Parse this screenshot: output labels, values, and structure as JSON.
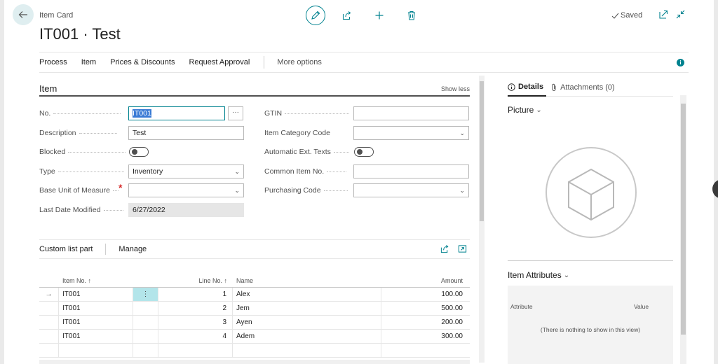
{
  "header": {
    "breadcrumb": "Item Card",
    "title": "IT001 · Test",
    "saved_label": "Saved",
    "icons": [
      "back-arrow-icon",
      "edit-pencil-icon",
      "share-icon",
      "add-plus-icon",
      "delete-trash-icon",
      "open-new-window-icon",
      "collapse-icon"
    ]
  },
  "actions": {
    "items": [
      "Process",
      "Item",
      "Prices & Discounts",
      "Request Approval"
    ],
    "more": "More options",
    "info": "i"
  },
  "section": {
    "title": "Item",
    "show_less": "Show less"
  },
  "fields": {
    "no_label": "No.",
    "no_value": "IT001",
    "no_more": "···",
    "description_label": "Description",
    "description_value": "Test",
    "blocked_label": "Blocked",
    "blocked_value": false,
    "type_label": "Type",
    "type_value": "Inventory",
    "base_uom_label": "Base Unit of Measure",
    "base_uom_value": "",
    "required_mark": "*",
    "last_modified_label": "Last Date Modified",
    "last_modified_value": "6/27/2022",
    "gtin_label": "GTIN",
    "gtin_value": "",
    "category_label": "Item Category Code",
    "category_value": "",
    "auto_ext_label": "Automatic Ext. Texts",
    "auto_ext_value": false,
    "common_item_label": "Common Item No.",
    "common_item_value": "",
    "purchasing_label": "Purchasing Code",
    "purchasing_value": ""
  },
  "list_part": {
    "title": "Custom list part",
    "manage": "Manage",
    "columns": {
      "item_no": "Item No. ↑",
      "line_no": "Line No. ↑",
      "name": "Name",
      "amount": "Amount"
    },
    "rows": [
      {
        "arrow": "→",
        "item_no": "IT001",
        "menu": "⋮",
        "line_no": "1",
        "name": "Alex",
        "amount": "100.00"
      },
      {
        "arrow": "",
        "item_no": "IT001",
        "menu": "",
        "line_no": "2",
        "name": "Jem",
        "amount": "500.00"
      },
      {
        "arrow": "",
        "item_no": "IT001",
        "menu": "",
        "line_no": "3",
        "name": "Ayen",
        "amount": "200.00"
      },
      {
        "arrow": "",
        "item_no": "IT001",
        "menu": "",
        "line_no": "4",
        "name": "Adem",
        "amount": "300.00"
      },
      {
        "arrow": "",
        "item_no": "",
        "menu": "",
        "line_no": "",
        "name": "",
        "amount": ""
      }
    ]
  },
  "factbox": {
    "tab_details": "Details",
    "tab_attachments": "Attachments (0)",
    "picture_title": "Picture",
    "attributes_title": "Item Attributes",
    "attr_col_attribute": "Attribute",
    "attr_col_value": "Value",
    "attr_empty": "(There is nothing to show in this view)"
  },
  "colors": {
    "accent": "#00828f",
    "selected_cell": "#b3e5ea",
    "required": "#d62d2d"
  }
}
